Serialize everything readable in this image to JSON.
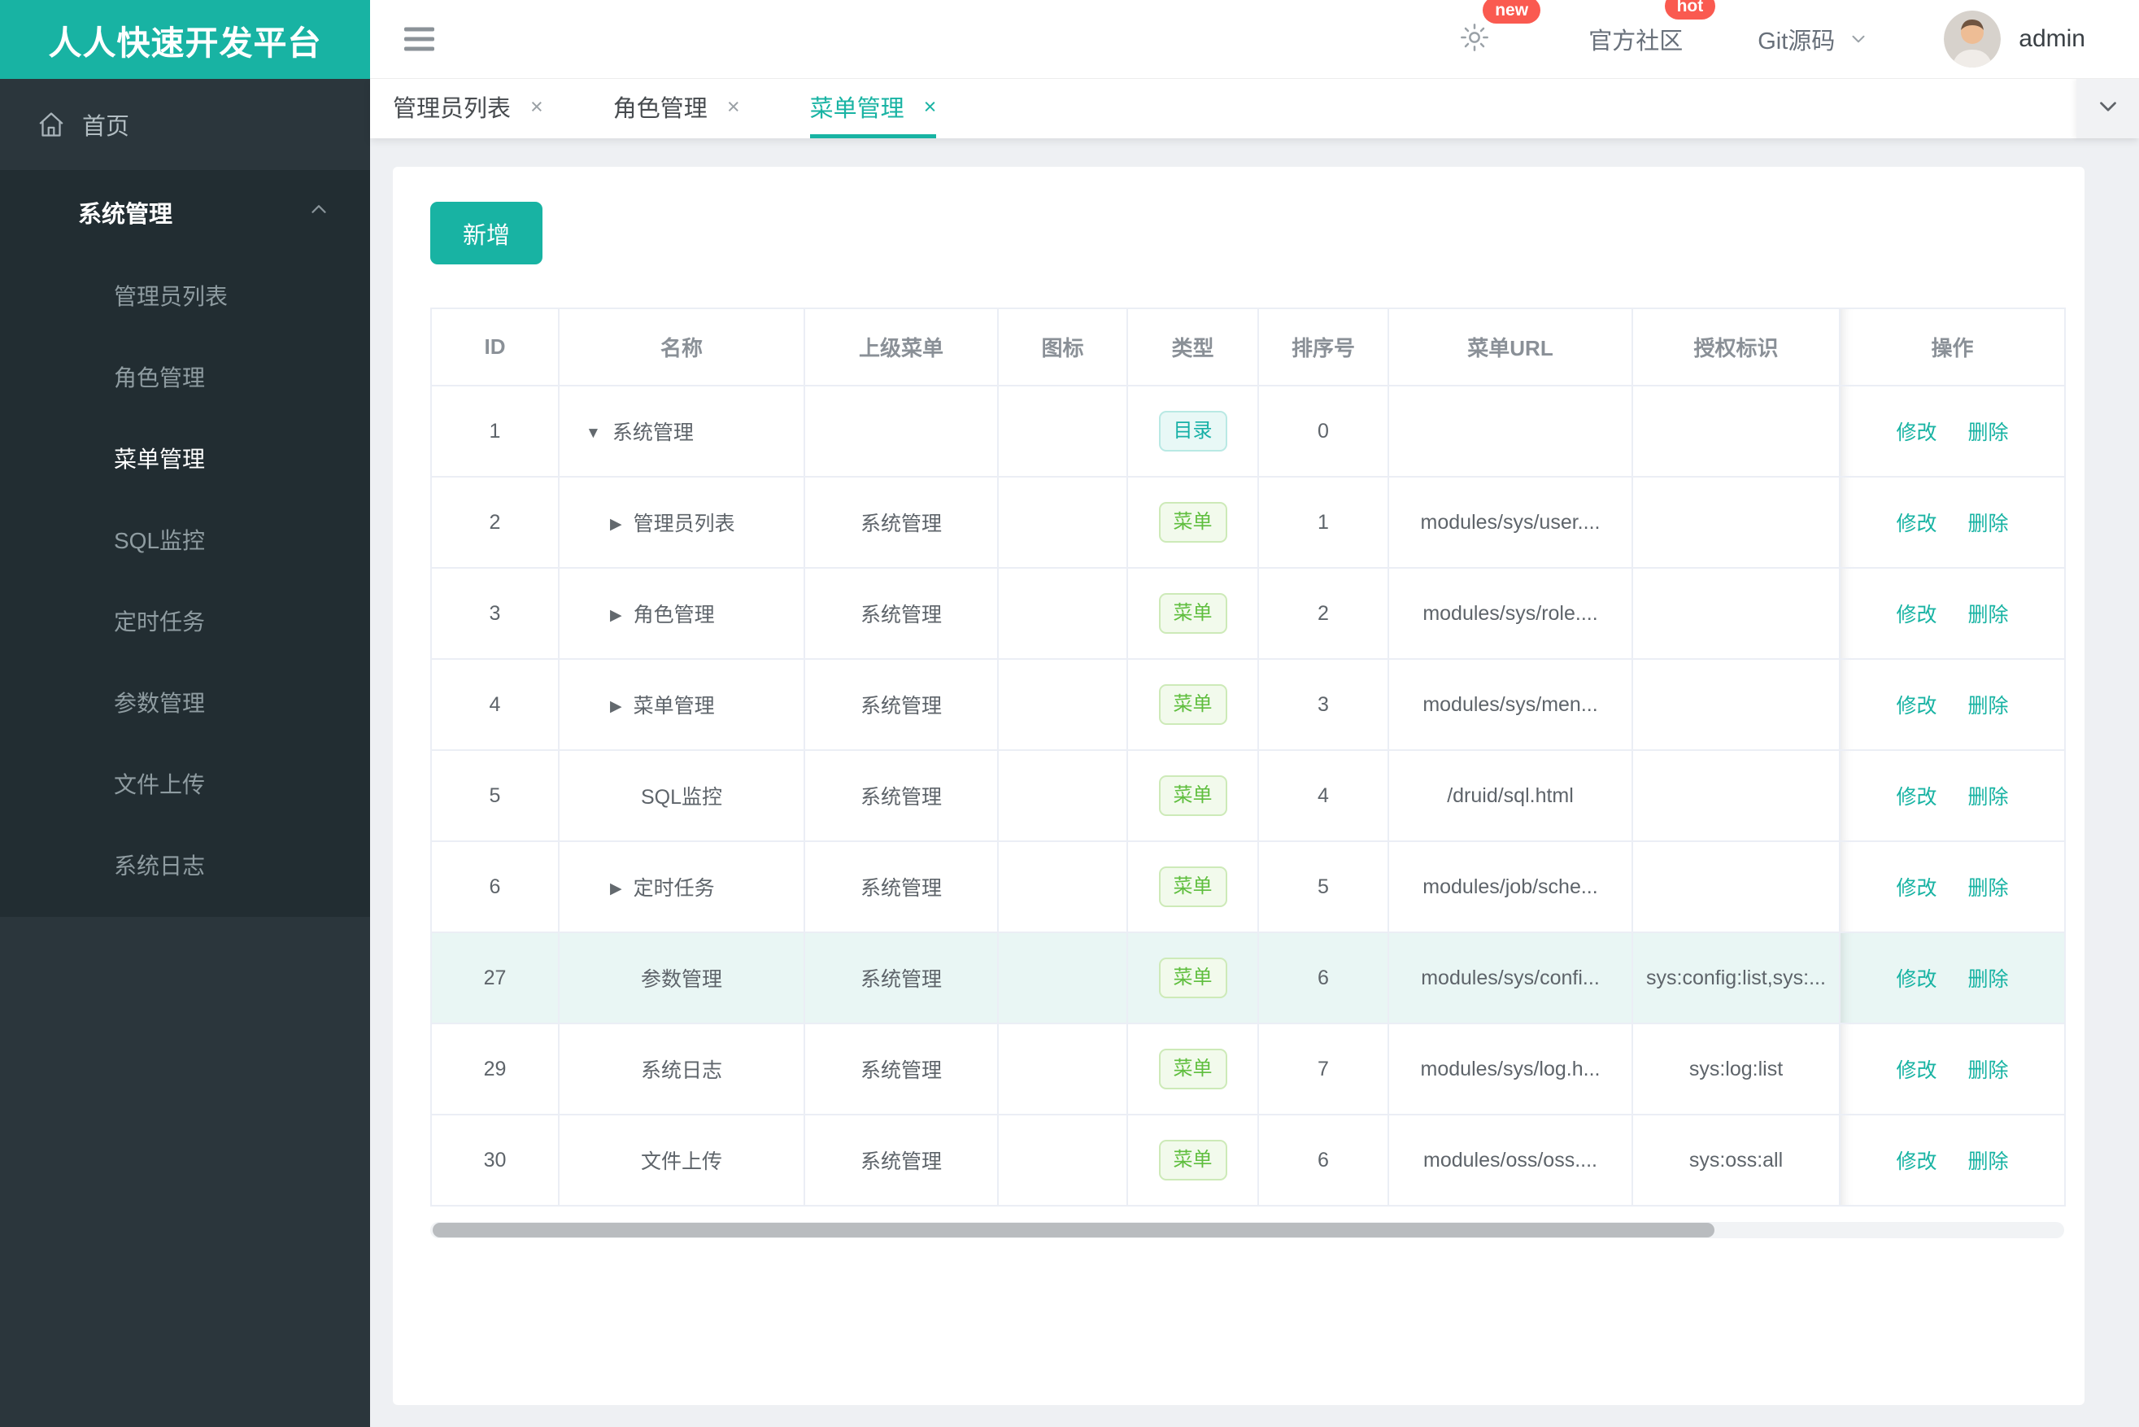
{
  "app": {
    "title": "人人快速开发平台"
  },
  "header": {
    "gear_badge": "new",
    "community": "官方社区",
    "community_badge": "hot",
    "git": "Git源码",
    "username": "admin"
  },
  "sidebar": {
    "home": "首页",
    "group": "系统管理",
    "active_item": "菜单管理",
    "items": [
      "管理员列表",
      "角色管理",
      "菜单管理",
      "SQL监控",
      "定时任务",
      "参数管理",
      "文件上传",
      "系统日志"
    ]
  },
  "tabs": {
    "items": [
      {
        "label": "管理员列表",
        "active": false
      },
      {
        "label": "角色管理",
        "active": false
      },
      {
        "label": "菜单管理",
        "active": true
      }
    ]
  },
  "toolbar": {
    "add": "新增"
  },
  "table": {
    "columns": [
      "ID",
      "名称",
      "上级菜单",
      "图标",
      "类型",
      "排序号",
      "菜单URL",
      "授权标识",
      "操作"
    ],
    "type_labels": {
      "dir": "目录",
      "menu": "菜单"
    },
    "actions": {
      "edit": "修改",
      "del": "删除"
    },
    "rows": [
      {
        "id": "1",
        "name": "系统管理",
        "expand": "expanded",
        "parent": "",
        "icon": "",
        "type": "dir",
        "order": "0",
        "url": "",
        "perm": "",
        "highlight": false
      },
      {
        "id": "2",
        "name": "管理员列表",
        "expand": "collapsed",
        "parent": "系统管理",
        "icon": "",
        "type": "menu",
        "order": "1",
        "url": "modules/sys/user....",
        "perm": "",
        "highlight": false
      },
      {
        "id": "3",
        "name": "角色管理",
        "expand": "collapsed",
        "parent": "系统管理",
        "icon": "",
        "type": "menu",
        "order": "2",
        "url": "modules/sys/role....",
        "perm": "",
        "highlight": false
      },
      {
        "id": "4",
        "name": "菜单管理",
        "expand": "collapsed",
        "parent": "系统管理",
        "icon": "",
        "type": "menu",
        "order": "3",
        "url": "modules/sys/men...",
        "perm": "",
        "highlight": false
      },
      {
        "id": "5",
        "name": "SQL监控",
        "expand": "none",
        "parent": "系统管理",
        "icon": "",
        "type": "menu",
        "order": "4",
        "url": "/druid/sql.html",
        "perm": "",
        "highlight": false
      },
      {
        "id": "6",
        "name": "定时任务",
        "expand": "collapsed",
        "parent": "系统管理",
        "icon": "",
        "type": "menu",
        "order": "5",
        "url": "modules/job/sche...",
        "perm": "",
        "highlight": false
      },
      {
        "id": "27",
        "name": "参数管理",
        "expand": "none",
        "parent": "系统管理",
        "icon": "",
        "type": "menu",
        "order": "6",
        "url": "modules/sys/confi...",
        "perm": "sys:config:list,sys:...",
        "highlight": true
      },
      {
        "id": "29",
        "name": "系统日志",
        "expand": "none",
        "parent": "系统管理",
        "icon": "",
        "type": "menu",
        "order": "7",
        "url": "modules/sys/log.h...",
        "perm": "sys:log:list",
        "highlight": false
      },
      {
        "id": "30",
        "name": "文件上传",
        "expand": "none",
        "parent": "系统管理",
        "icon": "",
        "type": "menu",
        "order": "6",
        "url": "modules/oss/oss....",
        "perm": "sys:oss:all",
        "highlight": false
      }
    ]
  },
  "colors": {
    "accent": "#18b3a3",
    "badge_red": "#fa5a50",
    "dir_badge": "#16b0a6",
    "menu_badge": "#5fbe3e",
    "row_highlight": "#e9f6f4",
    "sidebar_dark": "#222d32",
    "sidebar_base": "#2b363c"
  }
}
